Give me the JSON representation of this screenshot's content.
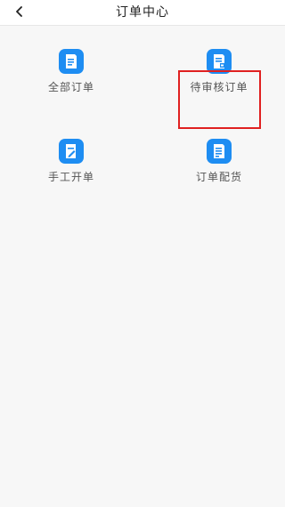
{
  "header": {
    "title": "订单中心",
    "back_icon": "chevron-left-icon"
  },
  "menu": [
    {
      "label": "全部订单",
      "icon": "document-icon"
    },
    {
      "label": "待审核订单",
      "icon": "document-review-icon"
    },
    {
      "label": "手工开单",
      "icon": "document-edit-icon"
    },
    {
      "label": "订单配货",
      "icon": "document-list-icon"
    }
  ],
  "colors": {
    "icon_blue": "#1e8df2",
    "highlight_red": "#e02020",
    "background": "#f7f7f7"
  }
}
